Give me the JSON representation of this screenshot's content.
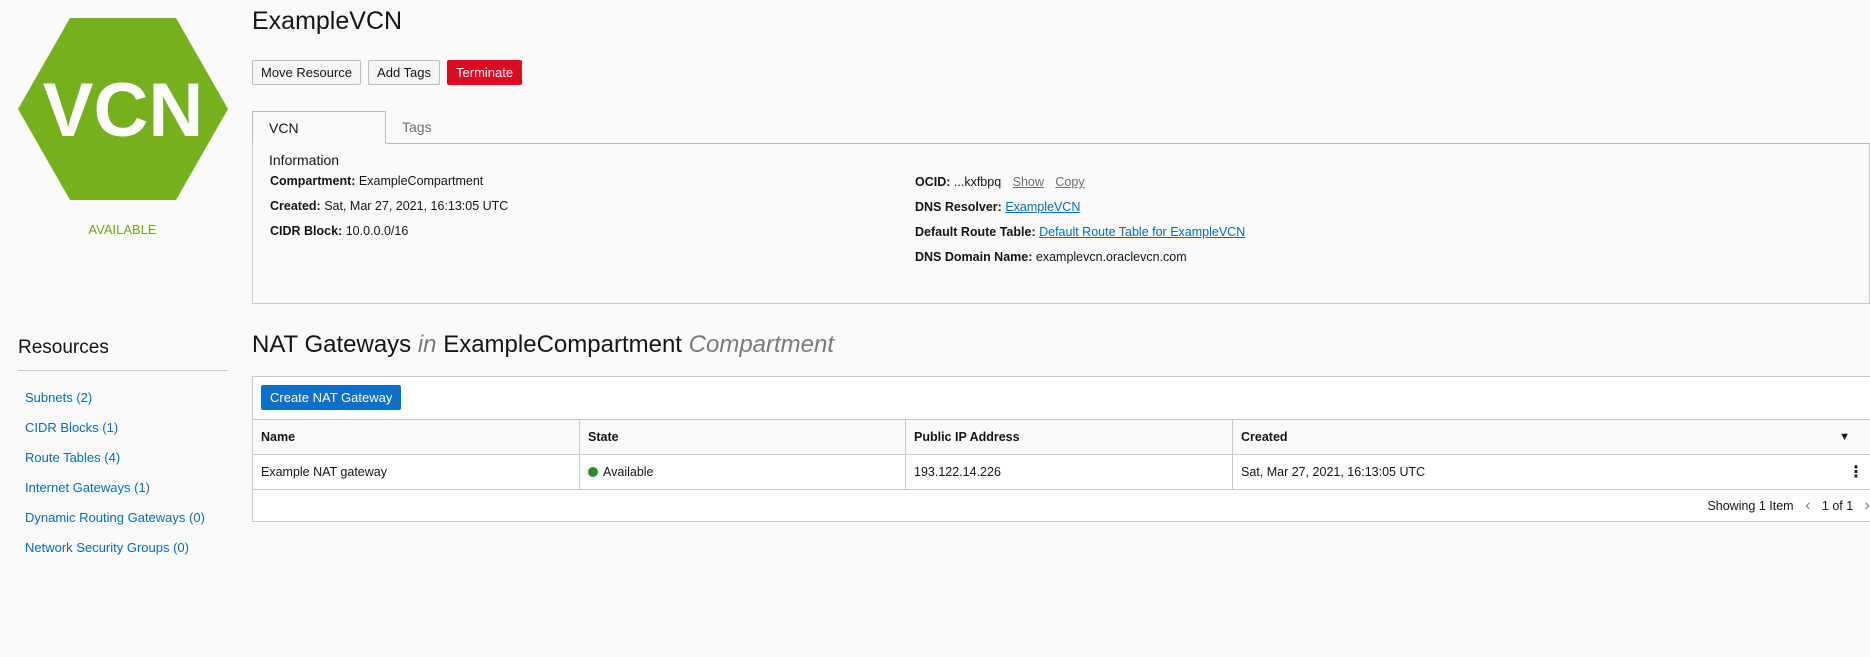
{
  "app": {
    "icon_text": "VCN",
    "icon_color": "#77b01f",
    "status": "AVAILABLE"
  },
  "sidebar": {
    "title": "Resources",
    "items": [
      {
        "label": "Subnets (2)"
      },
      {
        "label": "CIDR Blocks (1)"
      },
      {
        "label": "Route Tables (4)"
      },
      {
        "label": "Internet Gateways (1)"
      },
      {
        "label": "Dynamic Routing Gateways (0)"
      },
      {
        "label": "Network Security Groups (0)"
      }
    ]
  },
  "header": {
    "title": "ExampleVCN",
    "buttons": {
      "move": "Move Resource",
      "tags": "Add Tags",
      "terminate": "Terminate"
    }
  },
  "tabs": {
    "info": "VCN Information",
    "tags": "Tags"
  },
  "info": {
    "compartment_label": "Compartment:",
    "compartment_value": "ExampleCompartment",
    "created_label": "Created:",
    "created_value": "Sat, Mar 27, 2021, 16:13:05 UTC",
    "cidr_label": "CIDR Block:",
    "cidr_value": "10.0.0.0/16",
    "ocid_label": "OCID:",
    "ocid_value": "...kxfbpq",
    "ocid_show": "Show",
    "ocid_copy": "Copy",
    "dns_resolver_label": "DNS Resolver:",
    "dns_resolver_value": "ExampleVCN",
    "route_table_label": "Default Route Table:",
    "route_table_value": "Default Route Table for ExampleVCN",
    "dns_domain_label": "DNS Domain Name:",
    "dns_domain_value": "examplevcn.oraclevcn.com"
  },
  "nat": {
    "title_main": "NAT Gateways",
    "title_in": "in",
    "title_compartment": "ExampleCompartment",
    "title_suffix": "Compartment",
    "create_button": "Create NAT Gateway",
    "columns": {
      "name": "Name",
      "state": "State",
      "ip": "Public IP Address",
      "created": "Created"
    },
    "rows": [
      {
        "name": "Example NAT gateway",
        "state": "Available",
        "ip": "193.122.14.226",
        "created": "Sat, Mar 27, 2021, 16:13:05 UTC"
      }
    ],
    "pager": {
      "showing": "Showing 1 Item",
      "page": "1 of 1"
    }
  }
}
